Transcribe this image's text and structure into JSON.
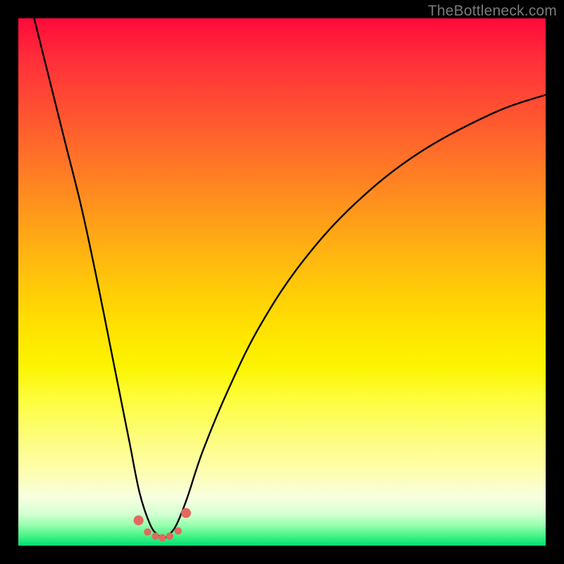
{
  "watermark": "TheBottleneck.com",
  "colors": {
    "page_bg": "#000000",
    "curve_stroke": "#000000",
    "marker_fill": "#e2695e",
    "watermark_text": "#7a7a7a"
  },
  "chart_data": {
    "type": "line",
    "title": "",
    "xlabel": "",
    "ylabel": "",
    "xlim": [
      0,
      100
    ],
    "ylim": [
      0,
      100
    ],
    "series": [
      {
        "name": "bottleneck-v-curve",
        "x": [
          3,
          6,
          9,
          12,
          15,
          18,
          21,
          23,
          25,
          26.5,
          27.5,
          28.5,
          30,
          32,
          35,
          40,
          46,
          54,
          64,
          76,
          90,
          100
        ],
        "y": [
          100,
          88,
          76,
          64,
          50,
          35,
          20,
          10,
          4,
          2,
          1.5,
          2,
          4,
          9,
          18,
          30,
          42,
          54,
          65,
          74.5,
          82,
          85.5
        ]
      }
    ],
    "markers": {
      "name": "highlighted-points",
      "x": [
        22.8,
        24.5,
        26.0,
        27.3,
        28.7,
        30.3,
        31.8
      ],
      "y": [
        4.8,
        2.6,
        1.8,
        1.5,
        1.8,
        2.8,
        6.2
      ]
    }
  }
}
